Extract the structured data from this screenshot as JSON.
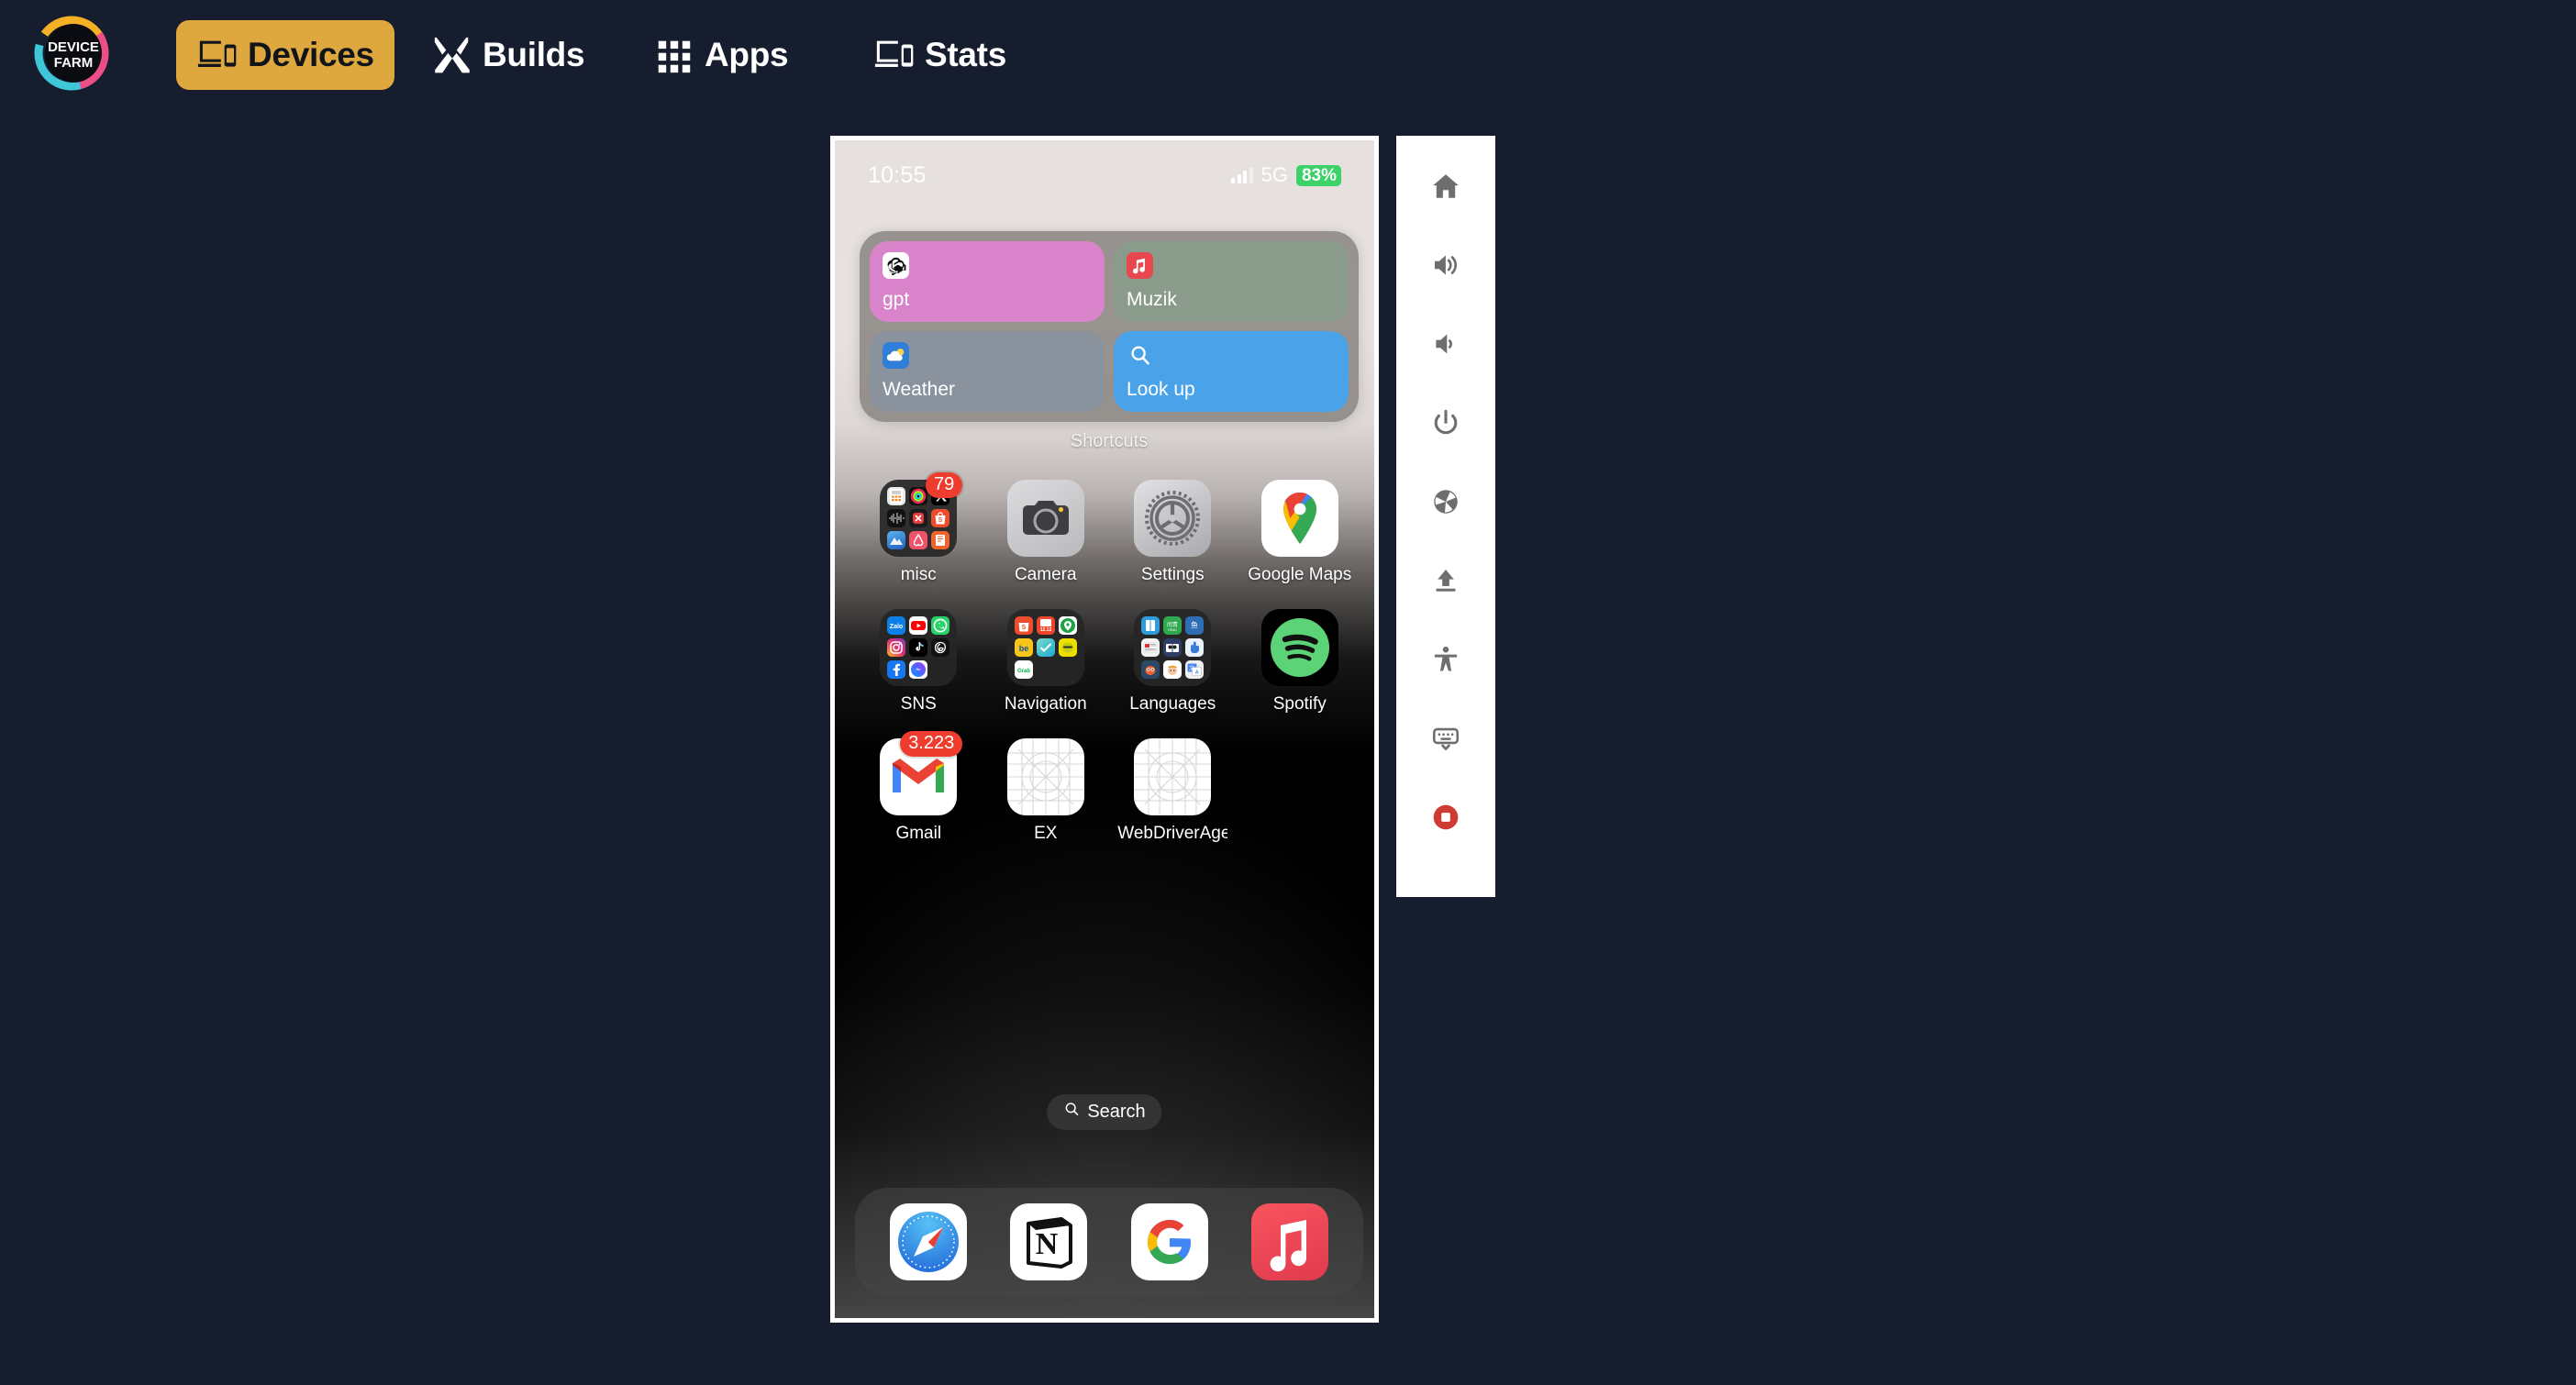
{
  "app": {
    "brand": "DEVICE FARM",
    "brand_line1": "DEVICE",
    "brand_line2": "FARM",
    "accent_color": "#dfa83e",
    "background_color": "#161d2e"
  },
  "topnav": {
    "items": [
      {
        "id": "devices",
        "label": "Devices",
        "icon": "laptop-phone-icon",
        "active": true
      },
      {
        "id": "builds",
        "label": "Builds",
        "icon": "tools-icon",
        "active": false
      },
      {
        "id": "apps",
        "label": "Apps",
        "icon": "grid-apps-icon",
        "active": false
      },
      {
        "id": "stats",
        "label": "Stats",
        "icon": "laptop-phone-icon",
        "active": false
      }
    ]
  },
  "device_screen": {
    "status_bar": {
      "time": "10:55",
      "network": "5G",
      "battery": "83%",
      "battery_color": "#3dd268",
      "signal_bars": 4
    },
    "widget": {
      "name": "Shortcuts",
      "tiles": [
        {
          "label": "gpt",
          "icon": "openai-icon",
          "color": "#d983ca"
        },
        {
          "label": "Muzik",
          "icon": "music-icon",
          "color": "#8b9b8b"
        },
        {
          "label": "Weather",
          "icon": "weather-icon",
          "color": "#8a929e"
        },
        {
          "label": "Look up",
          "icon": "search-icon",
          "color": "#4aa3e8"
        }
      ]
    },
    "apps": [
      {
        "label": "misc",
        "type": "folder",
        "badge": "79",
        "mini": [
          "calculator",
          "fitness-rings",
          "x-twitter",
          "audio-wave",
          "red-x-app",
          "shopee",
          "blue-peak",
          "airbnb",
          "orange-book"
        ]
      },
      {
        "label": "Camera",
        "type": "camera",
        "badge": null
      },
      {
        "label": "Settings",
        "type": "settings",
        "badge": null
      },
      {
        "label": "Google Maps",
        "type": "gmaps",
        "badge": null
      },
      {
        "label": "SNS",
        "type": "folder",
        "badge": null,
        "mini": [
          "zalo",
          "youtube",
          "whatsapp",
          "instagram",
          "tiktok",
          "threads",
          "facebook",
          "messenger",
          ""
        ]
      },
      {
        "label": "Navigation",
        "type": "folder",
        "badge": null,
        "mini": [
          "shopee",
          "lazada",
          "grabmap",
          "be",
          "traveloka",
          "line",
          "grab",
          "",
          ""
        ]
      },
      {
        "label": "Languages",
        "type": "folder",
        "badge": null,
        "mini": [
          "dict-blue",
          "green-read",
          "blue-fish",
          "news-red",
          "panda-book",
          "blue-hand",
          "orange-owl",
          "face-app",
          "translate"
        ]
      },
      {
        "label": "Spotify",
        "type": "spotify",
        "badge": null
      },
      {
        "label": "Gmail",
        "type": "gmail",
        "badge": "3.223"
      },
      {
        "label": "EX",
        "type": "placeholder",
        "badge": null
      },
      {
        "label": "WebDriverAgen…",
        "type": "placeholder",
        "badge": null
      }
    ],
    "search_pill": {
      "label": "Search",
      "icon": "search-icon"
    },
    "dock": [
      {
        "label": "Safari",
        "type": "safari"
      },
      {
        "label": "Notion",
        "type": "notion"
      },
      {
        "label": "Google",
        "type": "google"
      },
      {
        "label": "Apple Music",
        "type": "applemusic"
      }
    ]
  },
  "toolbar": {
    "buttons": [
      {
        "id": "home",
        "icon": "home-icon",
        "title": "Home"
      },
      {
        "id": "volume-up",
        "icon": "volume-up-icon",
        "title": "Volume Up"
      },
      {
        "id": "volume-down",
        "icon": "volume-down-icon",
        "title": "Volume Down"
      },
      {
        "id": "power",
        "icon": "power-icon",
        "title": "Power"
      },
      {
        "id": "screenshot",
        "icon": "camera-shutter-icon",
        "title": "Screenshot"
      },
      {
        "id": "upload",
        "icon": "upload-icon",
        "title": "Upload"
      },
      {
        "id": "accessibility",
        "icon": "accessibility-icon",
        "title": "Accessibility"
      },
      {
        "id": "hide-keyboard",
        "icon": "keyboard-hide-icon",
        "title": "Hide Keyboard"
      },
      {
        "id": "stop",
        "icon": "stop-record-icon",
        "title": "Stop",
        "color": "#cf3a32"
      }
    ]
  }
}
